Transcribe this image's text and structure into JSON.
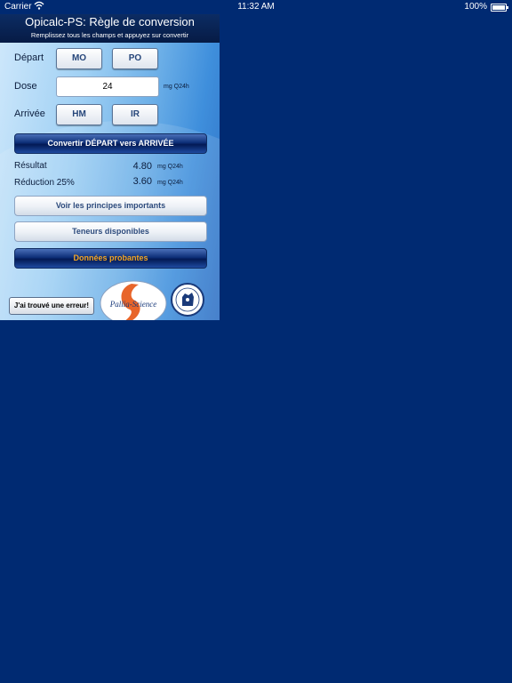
{
  "status_bar": {
    "carrier": "Carrier",
    "time": "11:32 AM",
    "battery": "100%"
  },
  "header": {
    "title": "Opicalc-PS: Règle de conversion",
    "subtitle": "Remplissez tous les champs et appuyez sur convertir"
  },
  "form": {
    "depart_label": "Départ",
    "depart_options": [
      "MO",
      "PO"
    ],
    "dose_label": "Dose",
    "dose_value": "24",
    "dose_unit": "mg Q24h",
    "arrivee_label": "Arrivée",
    "arrivee_options": [
      "HM",
      "IR"
    ]
  },
  "convert_button": "Convertir DÉPART vers ARRIVÉE",
  "results": {
    "resultat_label": "Résultat",
    "resultat_value": "4.80",
    "resultat_unit": "mg Q24h",
    "reduction_label": "Réduction 25%",
    "reduction_value": "3.60",
    "reduction_unit": "mg Q24h"
  },
  "buttons": {
    "principles": "Voir les principes importants",
    "teneurs": "Teneurs disponibles",
    "donnees": "Données probantes",
    "error": "J'ai trouvé une erreur!"
  },
  "logos": {
    "pallia": "Pallia-Science"
  },
  "colors": {
    "background": "#002a72",
    "accent_orange": "#f5a623",
    "logo_orange": "#e8652a"
  }
}
